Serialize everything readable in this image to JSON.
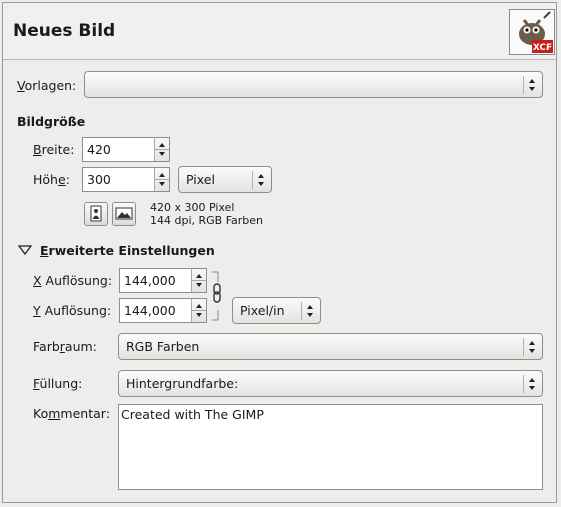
{
  "window": {
    "title": "Neues Bild",
    "icon_badge": "XCF"
  },
  "template": {
    "label_accel": "V",
    "label_rest": "orlagen:",
    "value": ""
  },
  "image_size": {
    "section_title": "Bildgröße",
    "width": {
      "label_accel": "B",
      "label_rest": "reite:",
      "value": "420"
    },
    "height": {
      "label_pre": "Höh",
      "label_accel": "e",
      "label_rest": ":",
      "value": "300"
    },
    "unit": "Pixel",
    "info_line1": "420 x 300 Pixel",
    "info_line2": "144 dpi, RGB Farben"
  },
  "advanced": {
    "section_accel": "E",
    "section_rest": "rweiterte Einstellungen",
    "expanded": true,
    "x_res": {
      "label_accel": "X",
      "label_rest": " Auflösung:",
      "value": "144,000"
    },
    "y_res": {
      "label_accel": "Y",
      "label_rest": " Auflösung:",
      "value": "144,000"
    },
    "res_unit": "Pixel/in",
    "colorspace": {
      "label_pre": "Farb",
      "label_accel": "r",
      "label_rest": "aum:",
      "value": "RGB Farben"
    },
    "fill": {
      "label_accel": "F",
      "label_rest": "üllung:",
      "value": "Hintergrundfarbe:"
    },
    "comment": {
      "label_pre": "Ko",
      "label_accel": "m",
      "label_rest": "mentar:",
      "value": "Created with The GIMP"
    }
  }
}
